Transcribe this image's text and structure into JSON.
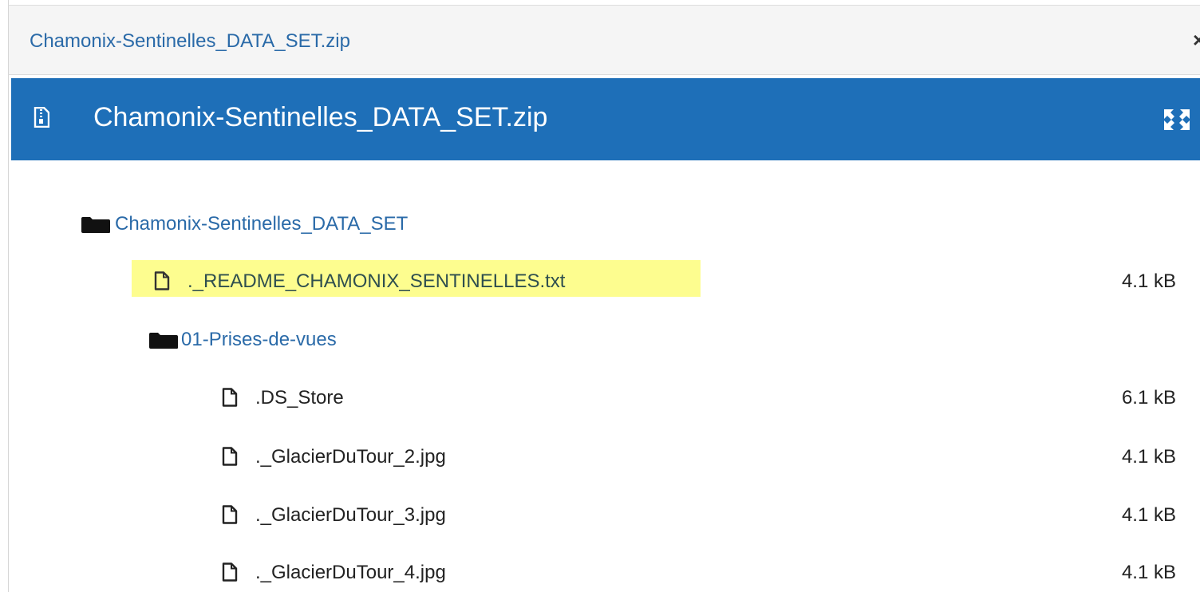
{
  "tab": {
    "title": "Chamonix-Sentinelles_DATA_SET.zip",
    "close_icon": "close-icon"
  },
  "header": {
    "title": "Chamonix-Sentinelles_DATA_SET.zip",
    "file_icon": "zip-file-icon",
    "expand_icon": "expand-icon"
  },
  "tree": {
    "root_folder": {
      "label": "Chamonix-Sentinelles_DATA_SET",
      "icon": "folder-icon"
    },
    "readme": {
      "label": "._README_CHAMONIX_SENTINELLES.txt",
      "size": "4.1 kB",
      "icon": "file-icon",
      "highlighted": true
    },
    "subfolder": {
      "label": "01-Prises-de-vues",
      "icon": "folder-icon"
    },
    "files": [
      {
        "label": ".DS_Store",
        "size": "6.1 kB",
        "icon": "file-icon"
      },
      {
        "label": "._GlacierDuTour_2.jpg",
        "size": "4.1 kB",
        "icon": "file-icon"
      },
      {
        "label": "._GlacierDuTour_3.jpg",
        "size": "4.1 kB",
        "icon": "file-icon"
      },
      {
        "label": "._GlacierDuTour_4.jpg",
        "size": "4.1 kB",
        "icon": "file-icon"
      }
    ]
  },
  "colors": {
    "header_bg": "#1e6fb8",
    "link": "#2a6aa8",
    "highlight": "#fdfd8f"
  }
}
